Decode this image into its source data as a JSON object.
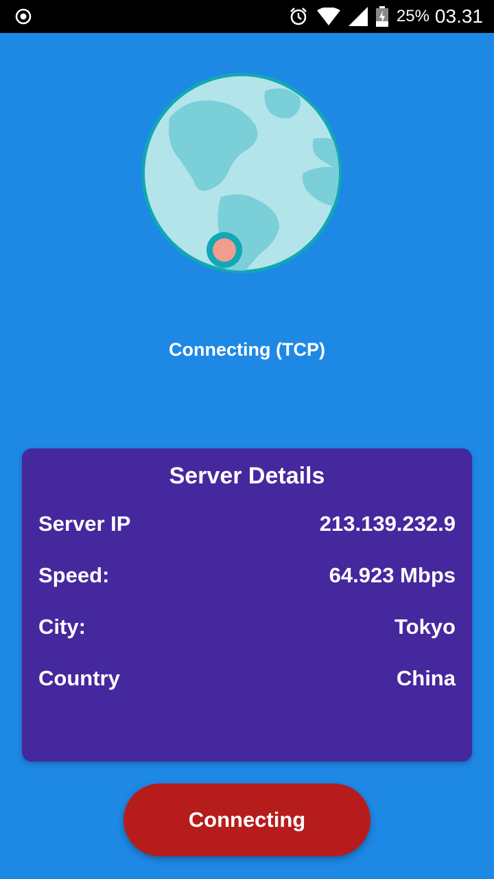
{
  "status_bar": {
    "battery_percent": "25%",
    "time": "03.31",
    "icons": [
      "record-icon",
      "alarm-icon",
      "wifi-icon",
      "signal-icon",
      "battery-charging-icon"
    ]
  },
  "globe": {
    "icon": "globe-icon"
  },
  "connection_status": "Connecting (TCP)",
  "server_details": {
    "title": "Server Details",
    "server_ip_label": "Server IP",
    "server_ip_value": "213.139.232.9",
    "speed_label": "Speed:",
    "speed_value": "64.923 Mbps",
    "city_label": "City:",
    "city_value": "Tokyo",
    "country_label": "Country",
    "country_value": "China"
  },
  "connect_button": {
    "label": "Connecting"
  },
  "colors": {
    "background": "#1e88e5",
    "card": "#45289e",
    "button": "#b71c1c",
    "globe_ocean": "#b2e4ea",
    "globe_land": "#7acfd8",
    "globe_border": "#12a7b4",
    "pin": "#f29b8f"
  }
}
